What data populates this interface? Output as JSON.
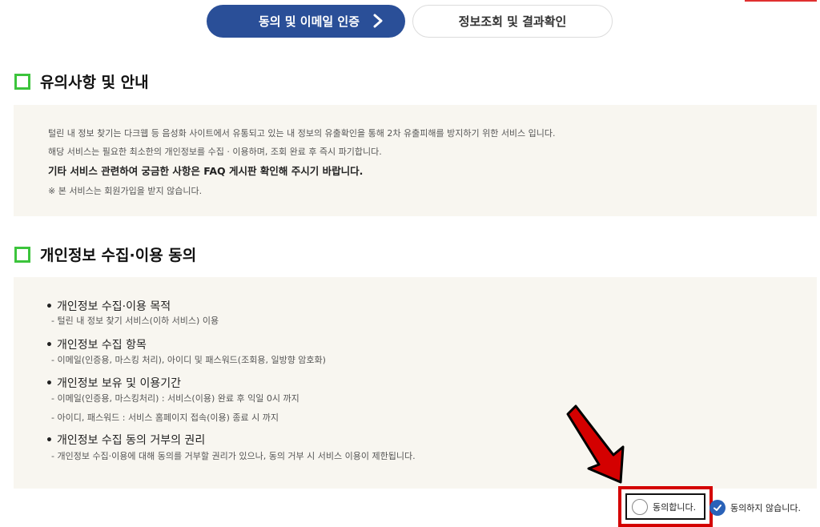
{
  "steps": [
    {
      "label": "동의 및 이메일 인증"
    },
    {
      "label": "정보조회 및 결과확인"
    }
  ],
  "notice": {
    "title": "유의사항 및 안내",
    "lines": [
      "털린 내 정보 찾기는 다크웹 등 음성화 사이트에서 유통되고 있는 내 정보의 유출확인을 통해 2차 유출피해를 방지하기 위한 서비스 입니다.",
      "해당 서비스는 필요한 최소한의 개인정보를 수집 · 이용하며, 조회 완료 후 즉시 파기합니다.",
      "기타 서비스 관련하여 궁금한 사항은 FAQ 게시판 확인해 주시기 바랍니다.",
      "※ 본 서비스는 회원가입을 받지 않습니다."
    ]
  },
  "consent": {
    "title": "개인정보 수집·이용 동의",
    "items": [
      {
        "heading": "개인정보 수집·이용 목적",
        "subs": [
          "- 털린 내 정보 찾기 서비스(이하 서비스) 이용"
        ]
      },
      {
        "heading": "개인정보 수집 항목",
        "subs": [
          "- 이메일(인증용, 마스킹 처리), 아이디 및 패스워드(조회용, 일방향 암호화)"
        ]
      },
      {
        "heading": "개인정보 보유 및 이용기간",
        "subs": [
          "- 이메일(인증용, 마스킹처리) : 서비스(이용) 완료 후 익일 0시 까지",
          "- 아이디, 패스워드 : 서비스 홈페이지 접속(이용) 종료 시 까지"
        ]
      },
      {
        "heading": "개인정보 수집 동의 거부의 권리",
        "subs": [
          "- 개인정보 수집·이용에 대해 동의를 거부할 권리가 있으나, 동의 거부 시 서비스 이용이 제한됩니다."
        ]
      }
    ],
    "bullet": "•",
    "agree_label": "동의합니다.",
    "disagree_label": "동의하지 않습니다.",
    "selected": "disagree"
  },
  "colors": {
    "step_active": "#2a4f98",
    "section_icon": "#3cc43c",
    "box_bg": "#f8f6f0",
    "highlight": "#d40000",
    "radio_checked": "#2a62b8"
  }
}
